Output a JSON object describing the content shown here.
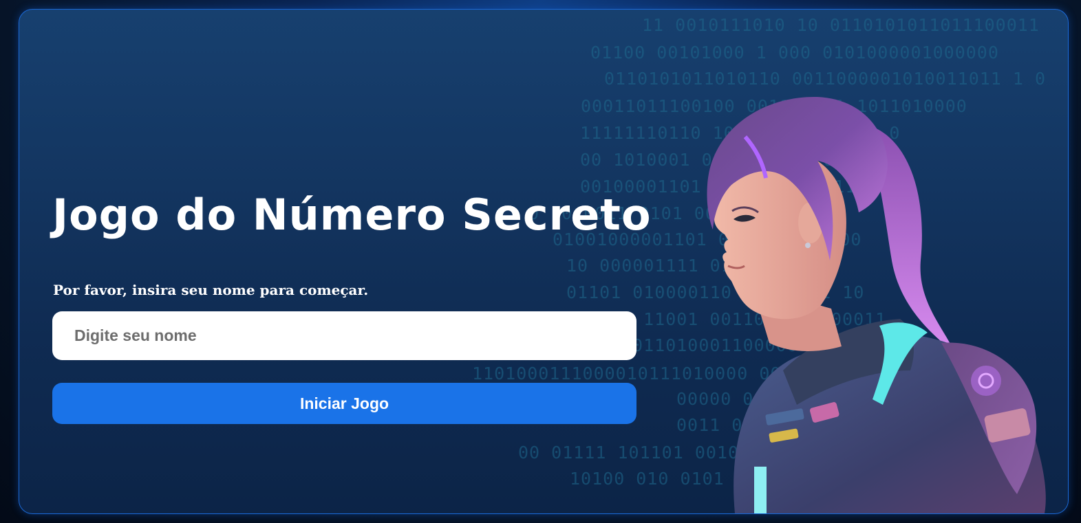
{
  "app": {
    "title": "Jogo do Número Secreto",
    "prompt": "Por favor, insira seu nome para começar."
  },
  "form": {
    "name_placeholder": "Digite seu nome",
    "name_value": "",
    "start_label": "Iniciar Jogo"
  },
  "background": {
    "binary_rows": [
      "11 0010111010 10 0110101011011100011",
      "01100 00101000 1  000 0101000001000000",
      "0110101011010110  0011000001010011011 1 0",
      "00011011100100    001101111  1011010000",
      "11111110110     101 01100000011 0",
      "00 1010001  0101  00111 0",
      "00100001101 100  000110011",
      "0 10 0011 0101  00101000001",
      "01001000001101  000 000011000",
      "10 000001111  01011000 11",
      "01101 010000110 10111111 10",
      "1 11001 001100  110100011",
      "101101000110000010  0110000",
      "1101000111000010111010000  0010 1",
      "00000  0100  00100001010000",
      "0011  01010  0110000",
      "00 01111   101101  0010 10111",
      "10100 010  0101  010000"
    ]
  },
  "colors": {
    "accent": "#1a73e8",
    "border": "#1b6ad8",
    "panel": "#133560",
    "binary": "#1f6a8e"
  }
}
